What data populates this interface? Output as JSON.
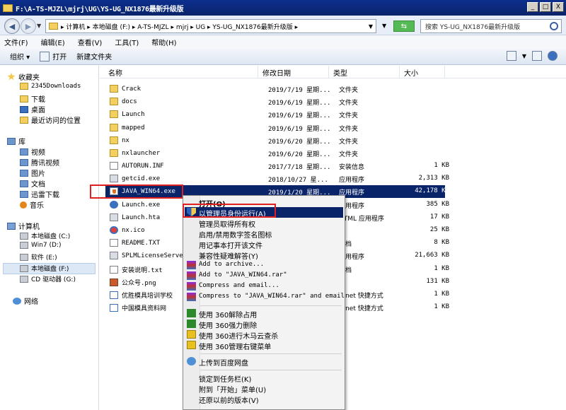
{
  "window": {
    "title": "F:\\A-TS-MJZL\\mjrj\\UG\\YS-UG_NX1876最新升级版",
    "minimize": "_",
    "maximize": "□",
    "close": "X"
  },
  "address_bar": {
    "path": "▸ 计算机 ▸ 本地磁盘 (F:) ▸ A-TS-MJZL ▸ mjrj ▸ UG ▸ YS-UG_NX1876最新升级版 ▸",
    "search_placeholder": "搜索 YS-UG_NX1876最新升级版"
  },
  "menu": [
    "文件(F)",
    "编辑(E)",
    "查看(V)",
    "工具(T)",
    "帮助(H)"
  ],
  "toolbar": {
    "organize": "组织 ▾",
    "open": "打开",
    "new_folder": "新建文件夹"
  },
  "nav": {
    "favorites": "收藏夹",
    "fav_items": [
      "2345Downloads",
      "下载",
      "桌面",
      "最近访问的位置"
    ],
    "libraries": "库",
    "lib_items": [
      "视频",
      "腾讯视频",
      "图片",
      "文档",
      "迅雷下载",
      "音乐"
    ],
    "computer": "计算机",
    "drives": [
      "本地磁盘 (C:)",
      "Win7 (D:)",
      "软件 (E:)",
      "本地磁盘 (F:)",
      "CD 驱动器 (G:)"
    ],
    "network": "网络"
  },
  "columns": {
    "name": "名称",
    "date": "修改日期",
    "type": "类型",
    "size": "大小"
  },
  "files": [
    {
      "name": "Crack",
      "date": "2019/7/19 星期...",
      "type": "文件夹",
      "size": "",
      "icon": "folder"
    },
    {
      "name": "docs",
      "date": "2019/6/19 星期...",
      "type": "文件夹",
      "size": "",
      "icon": "folder"
    },
    {
      "name": "Launch",
      "date": "2019/6/19 星期...",
      "type": "文件夹",
      "size": "",
      "icon": "folder"
    },
    {
      "name": "mapped",
      "date": "2019/6/19 星期...",
      "type": "文件夹",
      "size": "",
      "icon": "folder"
    },
    {
      "name": "nx",
      "date": "2019/6/20 星期...",
      "type": "文件夹",
      "size": "",
      "icon": "folder"
    },
    {
      "name": "nxlauncher",
      "date": "2019/6/20 星期...",
      "type": "文件夹",
      "size": "",
      "icon": "folder"
    },
    {
      "name": "AUTORUN.INF",
      "date": "2017/7/18 星期...",
      "type": "安装信息",
      "size": "1 KB",
      "icon": "txt"
    },
    {
      "name": "getcid.exe",
      "date": "2018/10/27 星...",
      "type": "应用程序",
      "size": "2,313 KB",
      "icon": "exe"
    },
    {
      "name": "JAVA_WIN64.exe",
      "date": "2019/1/20 星期...",
      "type": "应用程序",
      "size": "42,178 KB",
      "icon": "java"
    },
    {
      "name": "Launch.exe",
      "date": "",
      "type": "应用程序",
      "size": "385 KB",
      "icon": "blue"
    },
    {
      "name": "Launch.hta",
      "date": "",
      "type": "HTML 应用程序",
      "size": "17 KB",
      "icon": "exe"
    },
    {
      "name": "nx.ico",
      "date": "",
      "type": "",
      "size": "25 KB",
      "icon": "ico"
    },
    {
      "name": "README.TXT",
      "date": "",
      "type": "文档",
      "size": "8 KB",
      "icon": "txt"
    },
    {
      "name": "SPLMLicenseServer_",
      "date": "",
      "type": "应用程序",
      "size": "21,663 KB",
      "icon": "exe"
    },
    {
      "name": "安装说明.txt",
      "date": "",
      "type": "文档",
      "size": "1 KB",
      "icon": "txt"
    },
    {
      "name": "公众号.png",
      "date": "",
      "type": "",
      "size": "131 KB",
      "icon": "img"
    },
    {
      "name": "优胜模具培训学校",
      "date": "",
      "type": "ernet 快捷方式",
      "size": "1 KB",
      "icon": "lnk"
    },
    {
      "name": "中国模具资料网",
      "date": "",
      "type": "ernet 快捷方式",
      "size": "1 KB",
      "icon": "lnk"
    }
  ],
  "context_menu": {
    "open": "打开(O)",
    "run_as_admin": "以管理员身份运行(A)",
    "take_ownership": "管理员取得所有权",
    "toggle_signature": "启用/禁用数字签名图标",
    "open_notepad": "用记事本打开该文件",
    "compat": "兼容性疑难解答(Y)",
    "add_archive": "Add to archive...",
    "add_rar": "Add to \"JAVA_WIN64.rar\"",
    "compress_email": "Compress and email...",
    "compress_rar_email": "Compress to \"JAVA_WIN64.rar\" and email",
    "unlock_360": "使用 360解除占用",
    "force_delete_360": "使用 360强力删除",
    "trojan_scan_360": "使用 360进行木马云查杀",
    "manage_menu_360": "使用 360管理右键菜单",
    "upload_baidu": "上传到百度网盘",
    "pin_taskbar": "锁定到任务栏(K)",
    "pin_start": "附到「开始」菜单(U)",
    "restore_versions": "还原以前的版本(V)"
  },
  "colors": {
    "selection": "#0a246a",
    "highlight_outline": "#e02020",
    "titlebar": "#0a246a"
  }
}
